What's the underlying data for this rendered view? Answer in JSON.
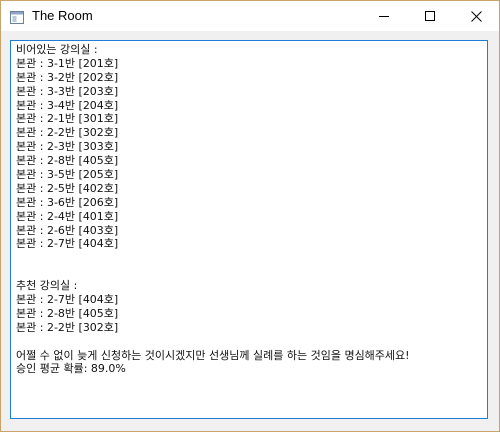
{
  "window": {
    "title": "The Room",
    "icon": "window-app-icon",
    "controls": [
      "minimize-icon",
      "maximize-icon",
      "close-icon"
    ]
  },
  "textbox": {
    "lines": [
      "비어있는 강의실 :",
      "본관 : 3-1반 [201호]",
      "본관 : 3-2반 [202호]",
      "본관 : 3-3반 [203호]",
      "본관 : 3-4반 [204호]",
      "본관 : 2-1반 [301호]",
      "본관 : 2-2반 [302호]",
      "본관 : 2-3반 [303호]",
      "본관 : 2-8반 [405호]",
      "본관 : 3-5반 [205호]",
      "본관 : 2-5반 [402호]",
      "본관 : 3-6반 [206호]",
      "본관 : 2-4반 [401호]",
      "본관 : 2-6반 [403호]",
      "본관 : 2-7반 [404호]",
      "",
      "",
      "추천 강의실 :",
      "본관 : 2-7반 [404호]",
      "본관 : 2-8반 [405호]",
      "본관 : 2-2반 [302호]",
      "",
      "어쩔 수 없이 늦게 신청하는 것이시겠지만 선생님께 실례를 하는 것임을 명심해주세요!",
      "승인 평균 확률: 89.0%"
    ]
  }
}
